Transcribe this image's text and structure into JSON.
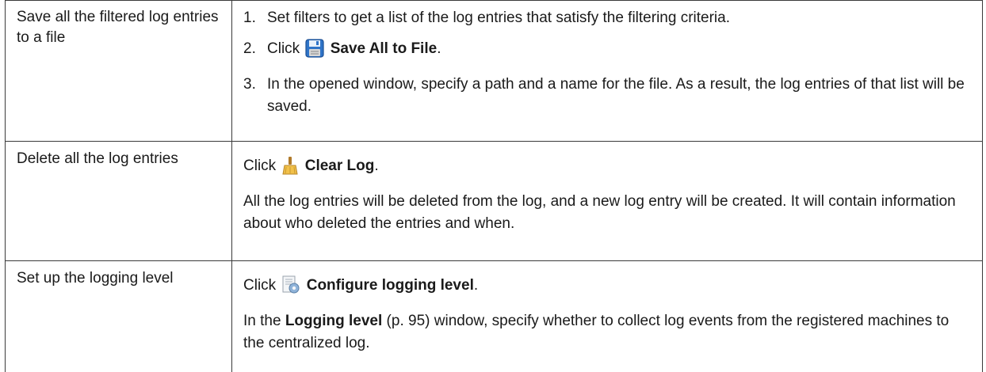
{
  "rows": [
    {
      "action": "Save all the filtered log entries to a file",
      "steps": [
        {
          "num": "1.",
          "text": "Set filters to get a list of the log entries that satisfy the filtering criteria."
        },
        {
          "num": "2.",
          "prefix": "Click",
          "bold": "Save All to File",
          "suffix": ".",
          "icon": "floppy-disk-icon"
        },
        {
          "num": "3.",
          "text": "In the opened window, specify a path and a name for the file. As a result, the log entries of that list will be saved."
        }
      ]
    },
    {
      "action": "Delete all the log entries",
      "click_prefix": "Click",
      "icon": "broom-icon",
      "bold": "Clear Log",
      "suffix": ".",
      "note": "All the log entries will be deleted from the log, and a new log entry will be created. It will contain information about who deleted the entries and when."
    },
    {
      "action": "Set up the logging level",
      "click_prefix": "Click",
      "icon": "gear-document-icon",
      "bold": "Configure logging level",
      "suffix": ".",
      "note_bold": "Logging level",
      "note_ref": " (p. 95)",
      "note_rest": " window, specify whether to collect log events from the registered machines to the centralized log."
    }
  ]
}
